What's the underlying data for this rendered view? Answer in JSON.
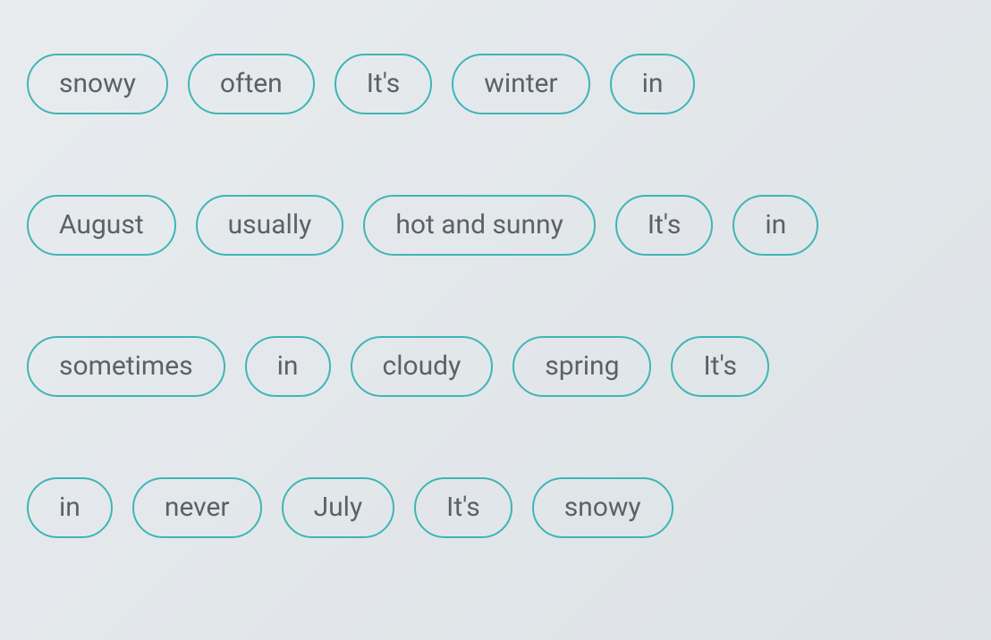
{
  "rows": [
    {
      "chips": [
        {
          "label": "snowy"
        },
        {
          "label": "often"
        },
        {
          "label": "It's"
        },
        {
          "label": "winter"
        },
        {
          "label": "in"
        }
      ]
    },
    {
      "chips": [
        {
          "label": "August"
        },
        {
          "label": "usually"
        },
        {
          "label": "hot and sunny"
        },
        {
          "label": "It's"
        },
        {
          "label": "in"
        }
      ]
    },
    {
      "chips": [
        {
          "label": "sometimes"
        },
        {
          "label": "in"
        },
        {
          "label": "cloudy"
        },
        {
          "label": "spring"
        },
        {
          "label": "It's"
        }
      ]
    },
    {
      "chips": [
        {
          "label": "in"
        },
        {
          "label": "never"
        },
        {
          "label": "July"
        },
        {
          "label": "It's"
        },
        {
          "label": "snowy"
        }
      ]
    }
  ]
}
